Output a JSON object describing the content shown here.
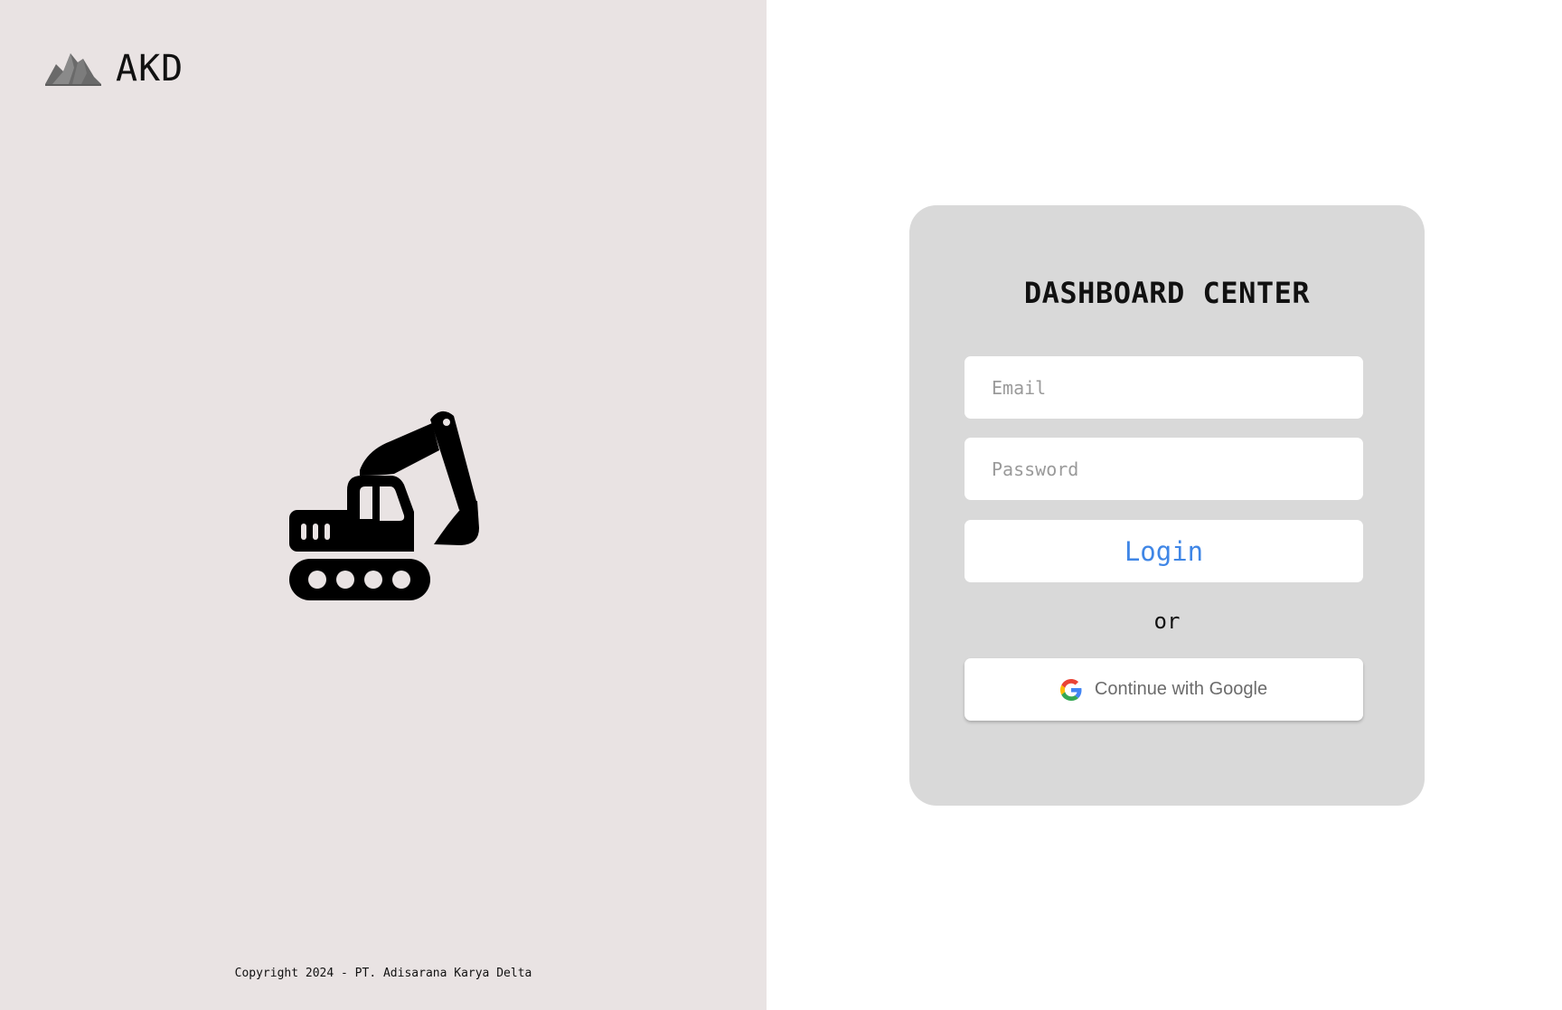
{
  "brand": {
    "name": "AKD",
    "logo_icon": "mountain-logo-icon"
  },
  "hero": {
    "icon": "excavator-icon"
  },
  "footer": {
    "copyright": "Copyright 2024 - PT. Adisarana Karya Delta"
  },
  "login_card": {
    "title": "DASHBOARD CENTER",
    "email_placeholder": "Email",
    "password_placeholder": "Password",
    "login_label": "Login",
    "separator": "or",
    "google_label": "Continue with Google",
    "google_icon": "google-logo-icon"
  },
  "colors": {
    "left_panel_bg": "#e9e3e3",
    "card_bg": "#d9d9d9",
    "login_text": "#3f86e6"
  }
}
